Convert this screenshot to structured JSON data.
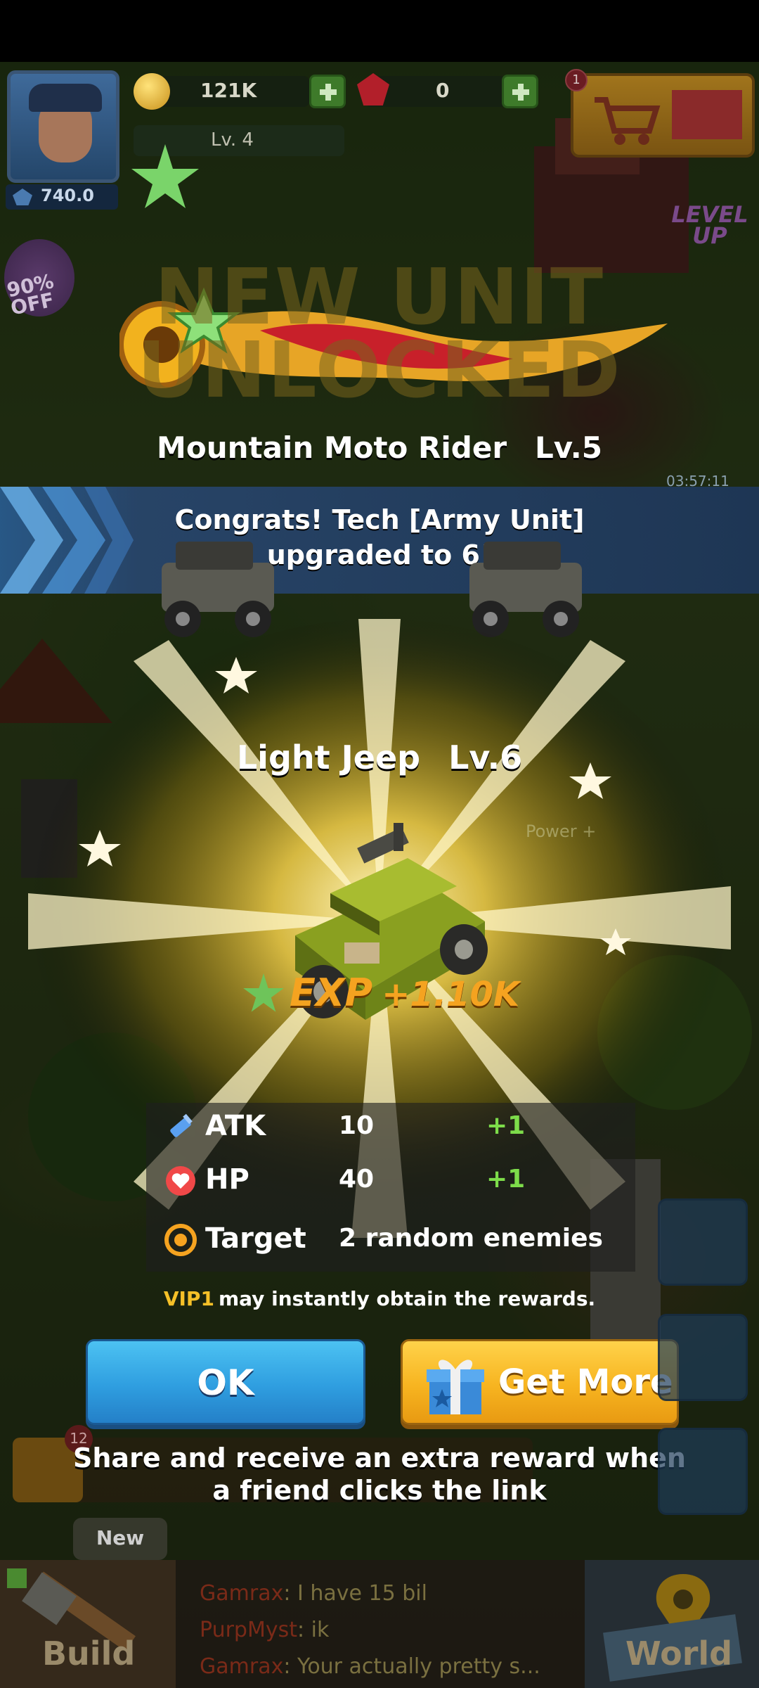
{
  "hud": {
    "coins": "121K",
    "gems": "0",
    "level": "Lv. 4",
    "power": "740.0",
    "shop_badge": "1",
    "sale_text": "90% OFF",
    "level_up_text": "LEVEL UP",
    "timer": "03:57:11"
  },
  "banner": {
    "title": "NEW UNIT UNLOCKED",
    "unlocked_unit_name": "Mountain Moto Rider",
    "unlocked_unit_level": "Lv.5"
  },
  "congrats": {
    "line1": "Congrats! Tech [Army Unit]",
    "line2": "upgraded to 6!"
  },
  "reward": {
    "unit_name": "Light Jeep",
    "unit_level": "Lv.6",
    "power_hint": "Power +",
    "exp_label": "EXP",
    "exp_value": "+1.10K"
  },
  "stats": [
    {
      "label": "ATK",
      "value": "10",
      "bonus": "+1",
      "icon": "syringe-icon"
    },
    {
      "label": "HP",
      "value": "40",
      "bonus": "+1",
      "icon": "heart-icon"
    },
    {
      "label": "Target",
      "value": "2 random enemies",
      "bonus": "",
      "icon": "target-icon"
    }
  ],
  "vip_note": {
    "vip": "VIP1",
    "text": "may instantly obtain the rewards."
  },
  "buttons": {
    "ok": "OK",
    "get_more": "Get More"
  },
  "share": {
    "line1": "Share and receive an extra reward when",
    "line2": "a friend clicks the link"
  },
  "bottom": {
    "task_count": "12",
    "new_tag": "New",
    "build": "Build",
    "world": "World",
    "chat": [
      {
        "user": "Gamrax",
        "message": ": I have 15 bil"
      },
      {
        "user": "PurpMyst",
        "message": ": ik"
      },
      {
        "user": "Gamrax",
        "message": ": Your actually pretty s..."
      }
    ]
  },
  "colors": {
    "ok_blue": "#2f9ee0",
    "get_more_yellow": "#f7b420",
    "bonus_green": "#7ddc4a",
    "vip_gold": "#f5c028",
    "exp_orange": "#f5a320"
  }
}
